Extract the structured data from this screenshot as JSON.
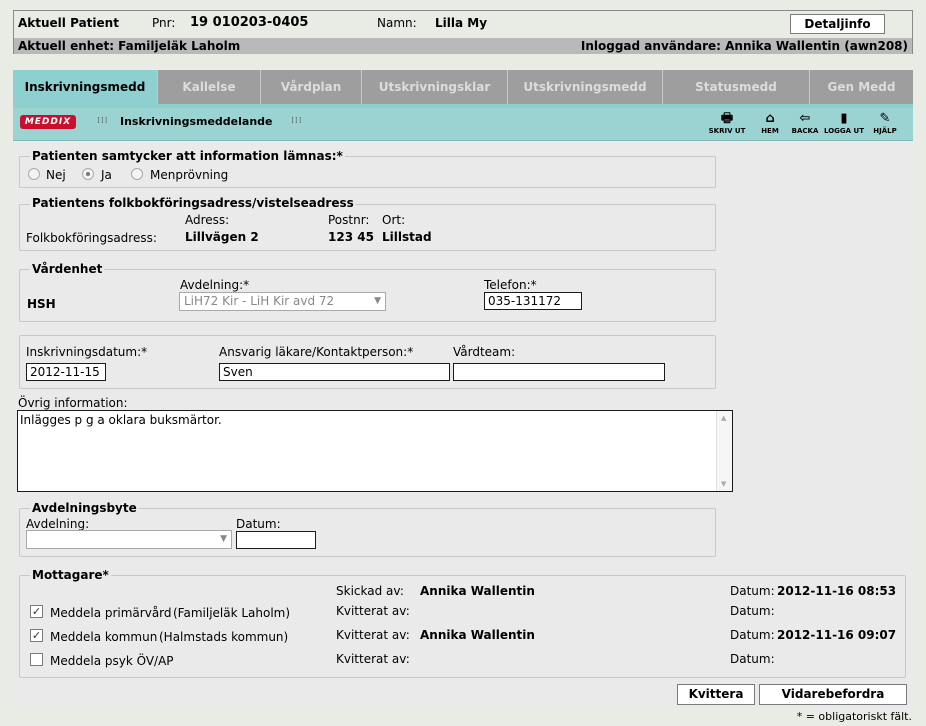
{
  "header": {
    "patient_label": "Aktuell Patient",
    "pnr_label": "Pnr:",
    "pnr_value": "19 010203-0405",
    "name_label": "Namn:",
    "name_value": "Lilla My",
    "detail_button": "Detaljinfo",
    "unit_text": "Aktuell enhet: Familjeläk Laholm",
    "user_text": "Inloggad användare: Annika Wallentin (awn208)"
  },
  "tabs": [
    {
      "label": "Inskrivningsmedd",
      "active": true
    },
    {
      "label": "Kallelse"
    },
    {
      "label": "Vårdplan"
    },
    {
      "label": "Utskrivningsklar"
    },
    {
      "label": "Utskrivningsmedd"
    },
    {
      "label": "Statusmedd"
    },
    {
      "label": "Gen Medd"
    }
  ],
  "toolbar": {
    "logo": "MEDDIX",
    "title": "Inskrivningsmeddelande",
    "buttons": [
      {
        "label": "SKRIV UT",
        "icon": "printer-icon",
        "glyph": "🖶"
      },
      {
        "label": "HEM",
        "icon": "home-icon",
        "glyph": "⌂"
      },
      {
        "label": "BACKA",
        "icon": "back-arrow-icon",
        "glyph": "⇦"
      },
      {
        "label": "LOGGA UT",
        "icon": "logout-door-icon",
        "glyph": "▮"
      },
      {
        "label": "HJÄLP",
        "icon": "help-book-icon",
        "glyph": "✎"
      }
    ]
  },
  "consent": {
    "legend": "Patienten samtycker att information lämnas:*",
    "options": [
      "Nej",
      "Ja",
      "Menprövning"
    ],
    "selected": "Ja"
  },
  "address": {
    "legend": "Patientens folkbokföringsadress/vistelseadress",
    "col_adress": "Adress:",
    "col_postnr": "Postnr:",
    "col_ort": "Ort:",
    "row_label": "Folkbokföringsadress:",
    "adress": "Lillvägen 2",
    "postnr": "123 45",
    "ort": "Lillstad"
  },
  "unit": {
    "legend": "Vårdenhet",
    "name": "HSH",
    "avdelning_label": "Avdelning:*",
    "avdelning_value": "LiH72 Kir - LiH Kir avd 72",
    "telefon_label": "Telefon:*",
    "telefon_value": "035-131172"
  },
  "admission": {
    "date_label": "Inskrivningsdatum:*",
    "date_value": "2012-11-15",
    "doctor_label": "Ansvarig läkare/Kontaktperson:*",
    "doctor_value": "Sven",
    "team_label": "Vårdteam:",
    "team_value": ""
  },
  "other": {
    "label": "Övrig information:",
    "text": "Inlägges p g a oklara buksmärtor."
  },
  "ward_change": {
    "legend": "Avdelningsbyte",
    "avdelning_label": "Avdelning:",
    "avdelning_value": "",
    "datum_label": "Datum:",
    "datum_value": ""
  },
  "recipients": {
    "legend": "Mottagare*",
    "sent_label": "Skickad av:",
    "sent_by": "Annika Wallentin",
    "sent_date_label": "Datum:",
    "sent_date": "2012-11-16 08:53",
    "rows": [
      {
        "checked": true,
        "label": "Meddela primärvård",
        "detail": "(Familjeläk Laholm)",
        "ack_label": "Kvitterat av:",
        "ack_by": "",
        "date_label": "Datum:",
        "date": ""
      },
      {
        "checked": true,
        "label": "Meddela kommun",
        "detail": "(Halmstads kommun)",
        "ack_label": "Kvitterat av:",
        "ack_by": "Annika Wallentin",
        "date_label": "Datum:",
        "date": "2012-11-16 09:07"
      },
      {
        "checked": false,
        "label": "Meddela psyk ÖV/AP",
        "detail": "",
        "ack_label": "Kvitterat av:",
        "ack_by": "",
        "date_label": "Datum:",
        "date": ""
      }
    ]
  },
  "actions": {
    "kvittera": "Kvittera",
    "vidarebefordra": "Vidarebefordra"
  },
  "footnote": "* = obligatoriskt fält."
}
